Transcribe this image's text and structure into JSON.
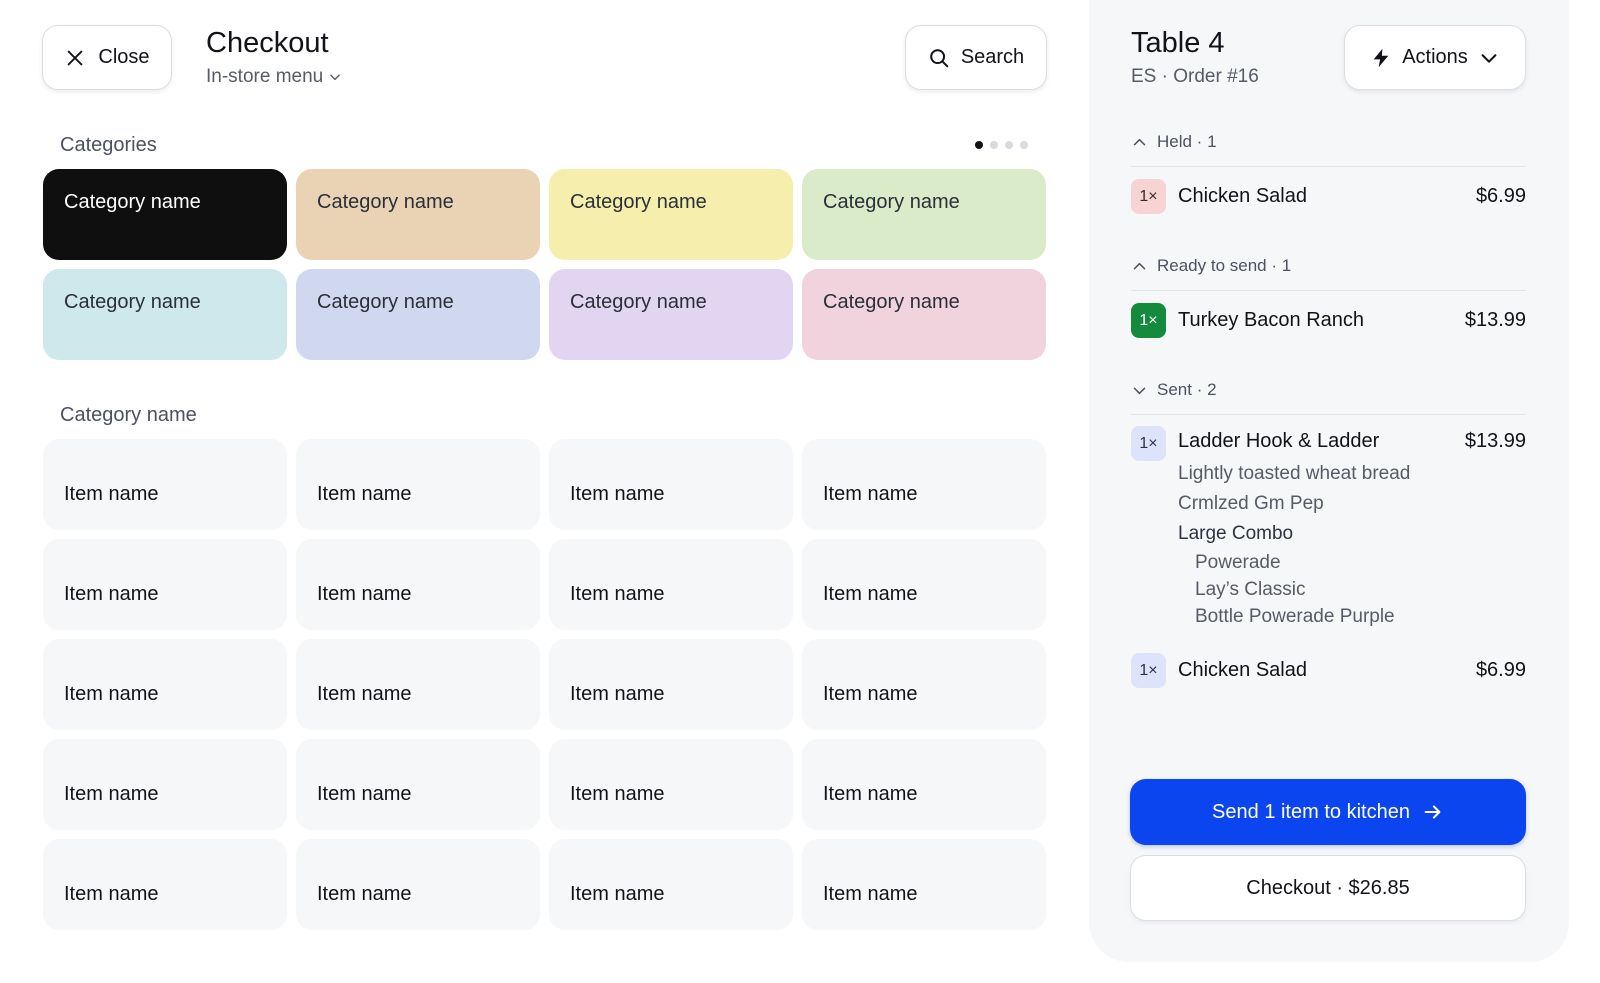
{
  "header": {
    "close_label": "Close",
    "title": "Checkout",
    "menu_selector": "In-store menu",
    "search_label": "Search"
  },
  "categories": {
    "heading": "Categories",
    "pager": {
      "total_pages": 4,
      "active_page": 1
    },
    "items": [
      {
        "label": "Category name",
        "color": "#0f0f10",
        "selected": true
      },
      {
        "label": "Category name",
        "color": "#e9d3b4"
      },
      {
        "label": "Category name",
        "color": "#f5eead"
      },
      {
        "label": "Category name",
        "color": "#d9ebc8"
      },
      {
        "label": "Category name",
        "color": "#cfe8ec"
      },
      {
        "label": "Category name",
        "color": "#cfd8ef"
      },
      {
        "label": "Category name",
        "color": "#e2d5f2"
      },
      {
        "label": "Category name",
        "color": "#f1d3dd"
      }
    ]
  },
  "menu_items": {
    "heading": "Category name",
    "items": [
      "Item name",
      "Item name",
      "Item name",
      "Item name",
      "Item name",
      "Item name",
      "Item name",
      "Item name",
      "Item name",
      "Item name",
      "Item name",
      "Item name",
      "Item name",
      "Item name",
      "Item name",
      "Item name",
      "Item name",
      "Item name",
      "Item name",
      "Item name"
    ]
  },
  "order": {
    "table": "Table 4",
    "subtitle": "ES · Order #16",
    "actions_label": "Actions",
    "groups": {
      "held": {
        "label": "Held · 1",
        "lines": [
          {
            "qty": "1×",
            "name": "Chicken Salad",
            "price": "$6.99"
          }
        ]
      },
      "ready": {
        "label": "Ready to send · 1",
        "lines": [
          {
            "qty": "1×",
            "name": "Turkey Bacon Ranch",
            "price": "$13.99"
          }
        ]
      },
      "sent": {
        "label": "Sent · 2",
        "lines": [
          {
            "qty": "1×",
            "name": "Ladder Hook & Ladder",
            "price": "$13.99",
            "modifiers": [
              "Lightly toasted wheat bread",
              "Crmlzed Gm Pep"
            ],
            "combo": {
              "label": "Large Combo",
              "items": [
                "Powerade",
                "Lay’s Classic",
                "Bottle Powerade Purple"
              ]
            }
          },
          {
            "qty": "1×",
            "name": "Chicken Salad",
            "price": "$6.99"
          }
        ]
      }
    },
    "send_label": "Send 1 item to kitchen",
    "checkout_label": "Checkout · $26.85"
  },
  "colors": {
    "accent": "#0a45f0",
    "ready_badge": "#148a3c",
    "held_badge": "#f8d3d3",
    "sent_badge": "#dde3fb"
  }
}
